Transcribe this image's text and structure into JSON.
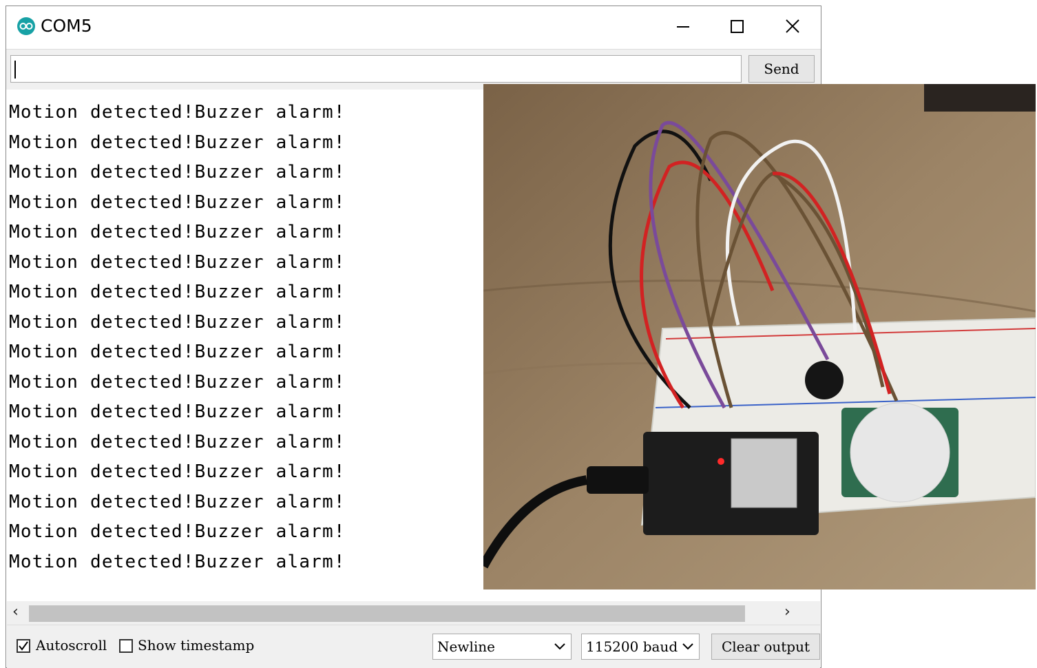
{
  "window": {
    "title": "COM5"
  },
  "send_bar": {
    "input_value": "",
    "send_label": "Send"
  },
  "output": {
    "lines": [
      "Motion detected!Buzzer alarm!",
      "Motion detected!Buzzer alarm!",
      "Motion detected!Buzzer alarm!",
      "Motion detected!Buzzer alarm!",
      "Motion detected!Buzzer alarm!",
      "Motion detected!Buzzer alarm!",
      "Motion detected!Buzzer alarm!",
      "Motion detected!Buzzer alarm!",
      "Motion detected!Buzzer alarm!",
      "Motion detected!Buzzer alarm!",
      "Motion detected!Buzzer alarm!",
      "Motion detected!Buzzer alarm!",
      "Motion detected!Buzzer alarm!",
      "Motion detected!Buzzer alarm!",
      "Motion detected!Buzzer alarm!",
      "Motion detected!Buzzer alarm!"
    ]
  },
  "bottom_bar": {
    "autoscroll_label": "Autoscroll",
    "autoscroll_checked": true,
    "timestamp_label": "Show timestamp",
    "timestamp_checked": false,
    "line_ending_value": "Newline",
    "baud_value": "115200 baud",
    "clear_label": "Clear output"
  },
  "icons": {
    "app": "arduino-logo-icon",
    "minimize": "minimize-icon",
    "maximize": "maximize-icon",
    "close": "close-icon",
    "scroll_left": "chevron-left-icon",
    "scroll_right": "chevron-right-icon",
    "dropdown": "chevron-down-icon"
  },
  "colors": {
    "app_icon": "#17a1a5",
    "chrome": "#f0f0f0"
  }
}
